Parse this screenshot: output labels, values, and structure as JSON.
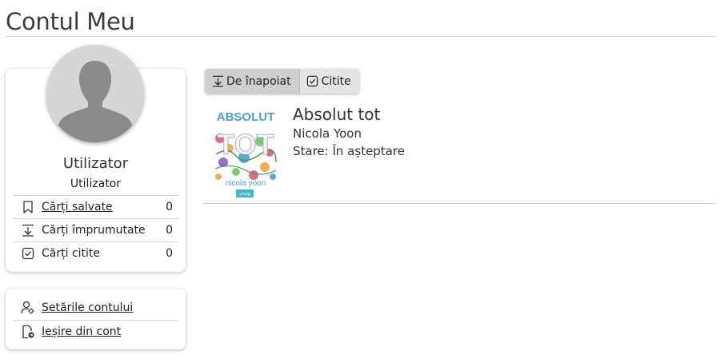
{
  "page": {
    "title": "Contul Meu"
  },
  "profile": {
    "name": "Utilizator",
    "role": "Utilizator",
    "stats": [
      {
        "label": "Cărți salvate",
        "count": "0",
        "icon": "bookmark-icon"
      },
      {
        "label": "Cărți împrumutate",
        "count": "0",
        "icon": "download-icon"
      },
      {
        "label": "Cărți citite",
        "count": "0",
        "icon": "checkbox-icon"
      }
    ]
  },
  "settings": {
    "account_settings": "Setările contului",
    "logout": "Ieșire din cont"
  },
  "tabs": [
    {
      "label": "De înapoiat",
      "icon": "download-icon",
      "active": true
    },
    {
      "label": "Citite",
      "icon": "checkbox-icon",
      "active": false
    }
  ],
  "book": {
    "title": "Absolut tot",
    "author": "Nicola Yoon",
    "status": "Stare: În așteptare",
    "cover": {
      "title_top": "ABSOLUT",
      "title_bottom": "TOT",
      "author": "nicola yoon",
      "publisher": "young"
    }
  },
  "colors": {
    "cover_title": "#4a9fd0",
    "publisher_badge": "#3fb7c9",
    "tab_active": "#cfcfcf",
    "tab_inactive": "#e4e4e4"
  }
}
